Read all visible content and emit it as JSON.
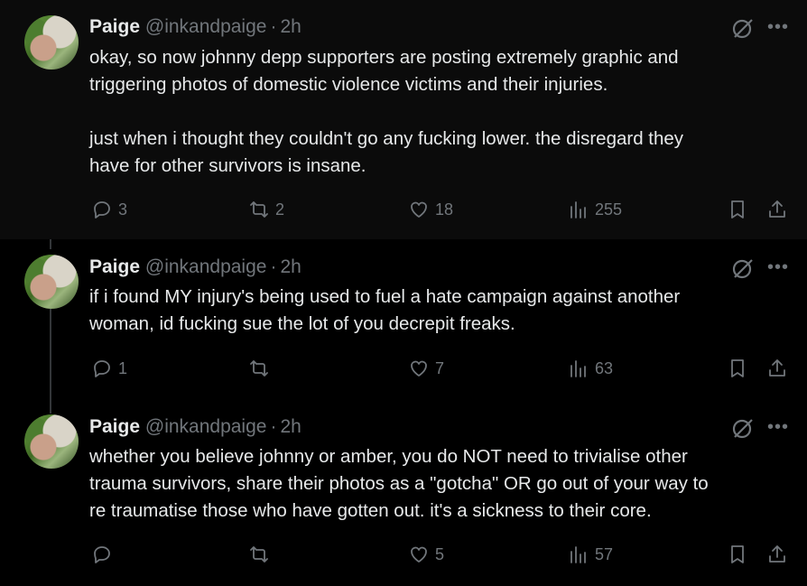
{
  "tweets": [
    {
      "name": "Paige",
      "handle": "@inkandpaige",
      "separator": "·",
      "time": "2h",
      "text_lines": [
        "okay, so now johnny depp supporters are posting extremely graphic and",
        "triggering photos of domestic violence victims and their injuries.",
        "",
        "just when i thought they couldn't go any fucking lower. the disregard they",
        "have for other survivors is insane."
      ],
      "replies": "3",
      "reposts": "2",
      "likes": "18",
      "views": "255"
    },
    {
      "name": "Paige",
      "handle": "@inkandpaige",
      "separator": "·",
      "time": "2h",
      "text_lines": [
        "if i found MY injury's being used to fuel a hate campaign against another",
        "woman, id fucking sue the lot of you decrepit freaks."
      ],
      "replies": "1",
      "reposts": "",
      "likes": "7",
      "views": "63"
    },
    {
      "name": "Paige",
      "handle": "@inkandpaige",
      "separator": "·",
      "time": "2h",
      "text_lines": [
        "whether you believe johnny or amber, you do NOT need to trivialise other",
        "trauma survivors, share their photos as a \"gotcha\" OR go out of your way to",
        "re traumatise those who have gotten out. it's a sickness to their core."
      ],
      "replies": "",
      "reposts": "",
      "likes": "5",
      "views": "57"
    }
  ],
  "icons": {
    "reply": "reply-icon",
    "repost": "repost-icon",
    "like": "heart-icon",
    "views": "views-icon",
    "bookmark": "bookmark-icon",
    "share": "share-icon",
    "grok": "grok-icon",
    "more": "more-icon"
  },
  "colors": {
    "background": "#000000",
    "first_tweet_background": "#0b0b0b",
    "text": "#e7e9ea",
    "muted": "#71767b"
  }
}
